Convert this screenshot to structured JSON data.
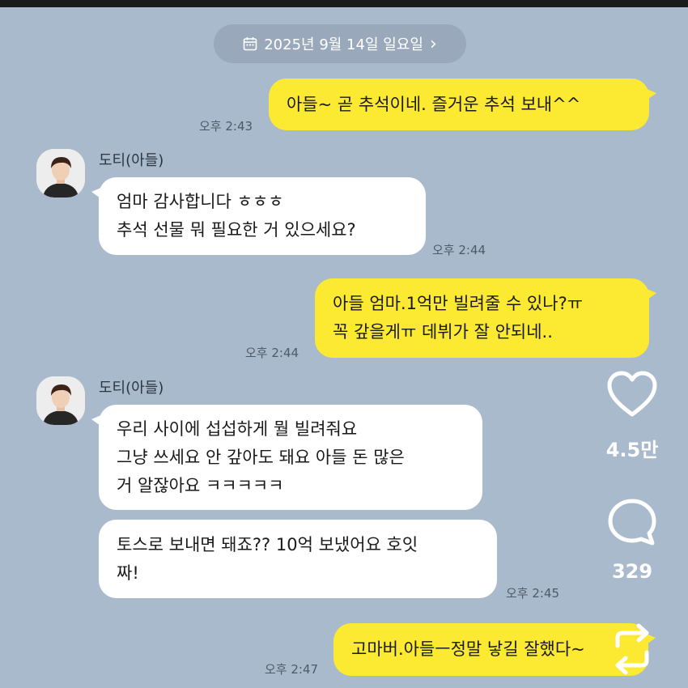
{
  "date_header": {
    "label": "2025년 9월 14일 일요일",
    "icon": "calendar-icon",
    "chevron": "›"
  },
  "messages": [
    {
      "sender": "me",
      "lines": [
        "아들~ 곧 추석이네. 즐거운 추석 보내^^"
      ],
      "time": "오후 2:43"
    },
    {
      "sender": "other",
      "name": "도티(아들)",
      "lines": [
        "엄마 감사합니다 ㅎㅎㅎ",
        "추석 선물 뭐 필요한 거 있으세요?"
      ],
      "time": "오후 2:44"
    },
    {
      "sender": "me",
      "lines": [
        "아들 엄마.1억만 빌려줄 수 있나?ㅠ",
        "꼭 갚을게ㅠ 데뷔가 잘 안되네.."
      ],
      "time": "오후 2:44"
    },
    {
      "sender": "other",
      "name": "도티(아들)",
      "lines": [
        "우리 사이에 섭섭하게 뭘 빌려줘요",
        "그냥 쓰세요 안 갚아도 돼요 아들 돈 많은",
        "거 알잖아요 ㅋㅋㅋㅋㅋ"
      ]
    },
    {
      "sender": "other",
      "lines": [
        "토스로 보내면 돼죠?? 10억 보냈어요 호잇",
        "짜!"
      ],
      "time": "오후 2:45"
    },
    {
      "sender": "me",
      "lines": [
        "고마버.아들ㅡ정말 낳길 잘했다~"
      ],
      "time": "오후 2:47"
    }
  ],
  "side_actions": {
    "like": {
      "icon": "heart-icon",
      "count": "4.5만"
    },
    "comment": {
      "icon": "comment-bubble-icon",
      "count": "329"
    },
    "share": {
      "icon": "repost-icon"
    }
  },
  "colors": {
    "background": "#a9bacd",
    "my_bubble": "#fce932",
    "other_bubble": "#ffffff"
  }
}
